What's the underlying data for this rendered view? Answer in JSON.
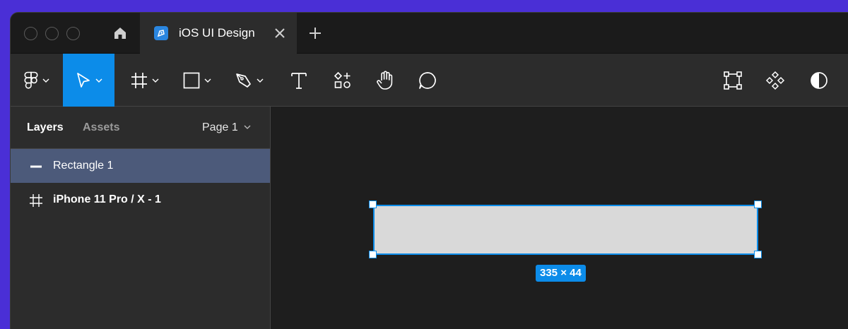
{
  "titlebar": {
    "tab_title": "iOS UI Design"
  },
  "toolbar": {
    "tools": [
      {
        "name": "main-menu",
        "icon": "figma-logo-icon",
        "active": false
      },
      {
        "name": "move",
        "icon": "cursor-arrow-icon",
        "active": true
      },
      {
        "name": "frame",
        "icon": "hash-frame-icon",
        "active": false
      },
      {
        "name": "shape",
        "icon": "rectangle-icon",
        "active": false
      },
      {
        "name": "pen",
        "icon": "pen-icon",
        "active": false
      },
      {
        "name": "text",
        "icon": "text-icon",
        "active": false
      },
      {
        "name": "resources",
        "icon": "resources-icon",
        "active": false
      },
      {
        "name": "hand",
        "icon": "hand-icon",
        "active": false
      },
      {
        "name": "comment",
        "icon": "comment-icon",
        "active": false
      }
    ],
    "right_tools": [
      "component-icon",
      "create-component-icon",
      "contrast-icon"
    ],
    "accent": "#0c8ce9"
  },
  "sidebar": {
    "tabs": {
      "layers": "Layers",
      "assets": "Assets"
    },
    "page_selector": "Page 1",
    "layers": [
      {
        "label": "Rectangle 1",
        "icon": "rectangle-layer-icon",
        "selected": true
      },
      {
        "label": "iPhone 11 Pro / X - 1",
        "icon": "frame-layer-icon",
        "selected": false
      }
    ]
  },
  "canvas": {
    "selection_dimensions": "335 × 44",
    "rect_fill": "#d9d9d9",
    "selection_color": "#0c8ce9"
  }
}
